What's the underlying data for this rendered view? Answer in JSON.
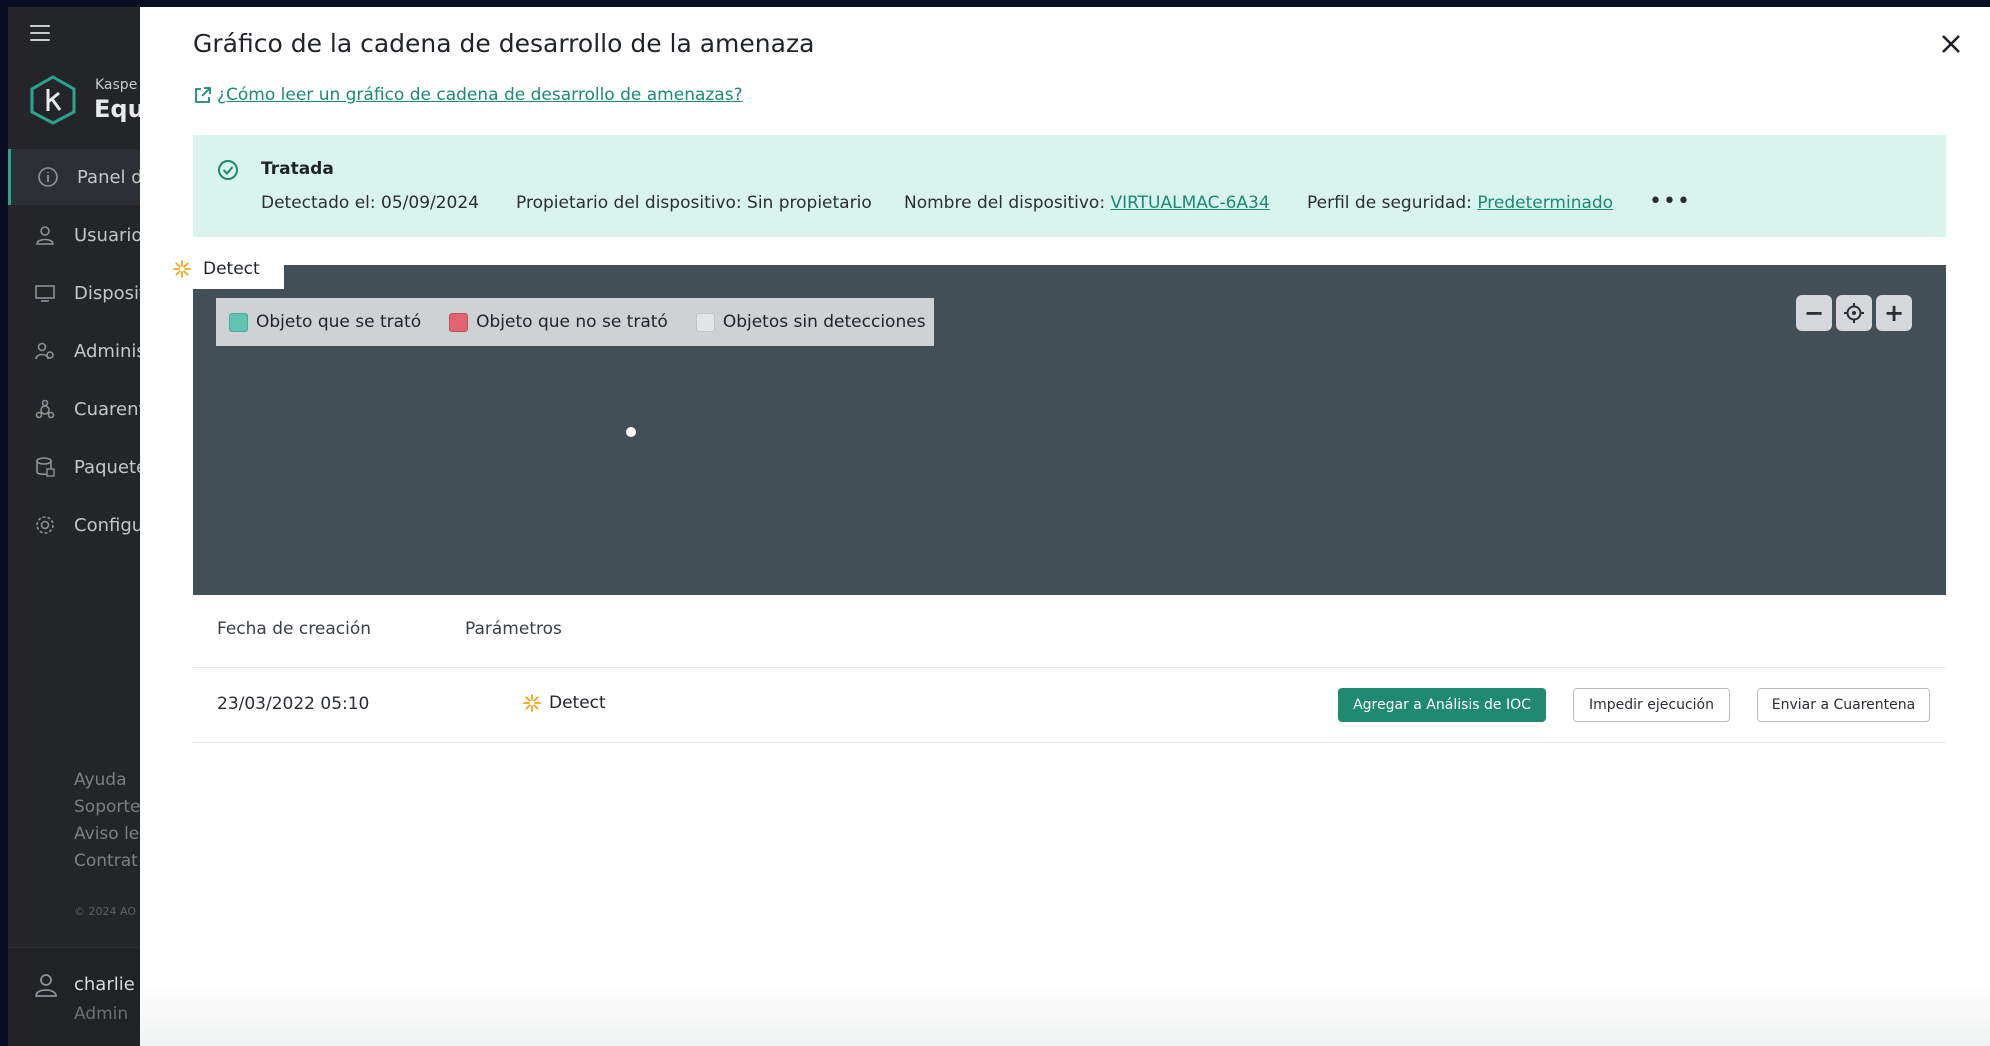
{
  "sidebar": {
    "brand_top": "Kaspe",
    "brand_main": "Equi",
    "items": [
      {
        "label": "Panel de",
        "icon": "info-icon"
      },
      {
        "label": "Usuarios",
        "icon": "user-icon"
      },
      {
        "label": "Disposit",
        "icon": "device-icon"
      },
      {
        "label": "Adminis",
        "icon": "admin-icon"
      },
      {
        "label": "Cuarent",
        "icon": "quarantine-icon"
      },
      {
        "label": "Paquete",
        "icon": "package-icon"
      },
      {
        "label": "Configu",
        "icon": "gear-icon"
      }
    ],
    "footer_links": [
      "Ayuda",
      "Soporte",
      "Aviso le",
      "Contrat"
    ],
    "copyright": "© 2024 AO",
    "user": {
      "name": "charlie",
      "role": "Admin"
    }
  },
  "panel": {
    "title": "Gráfico de la cadena de desarrollo de la amenaza",
    "help_link": "¿Cómo leer un gráfico de cadena de desarrollo de amenazas?",
    "status": {
      "title": "Tratada",
      "detected": "Detectado el: 05/09/2024",
      "owner": "Propietario del dispositivo: Sin propietario",
      "device_label": "Nombre del dispositivo: ",
      "device_name": "VIRTUALMAC-6A34",
      "profile_label": "Perfil de seguridad: ",
      "profile_name": "Predeterminado",
      "more": "•••"
    },
    "graph": {
      "label": "Detect",
      "legend": [
        {
          "label": "Objeto que se trató",
          "color": "#5fc4b2"
        },
        {
          "label": "Objeto que no se trató",
          "color": "#e0646f"
        },
        {
          "label": "Objetos sin detecciones",
          "color": "#e2e4e6"
        }
      ],
      "zoom_out": "−",
      "zoom_in": "+"
    },
    "table": {
      "headers": [
        "Fecha de creación",
        "Parámetros"
      ],
      "row": {
        "date": "23/03/2022 05:10",
        "param": "Detect"
      }
    },
    "actions": {
      "ioc": "Agregar a Análisis de IOC",
      "block": "Impedir ejecución",
      "quarantine": "Enviar a Cuarentena"
    }
  },
  "colors": {
    "accent": "#1f8a70",
    "status_bg": "#d9f4ec",
    "graph_bg": "#434f56",
    "detect_icon": "#f2a51a"
  }
}
